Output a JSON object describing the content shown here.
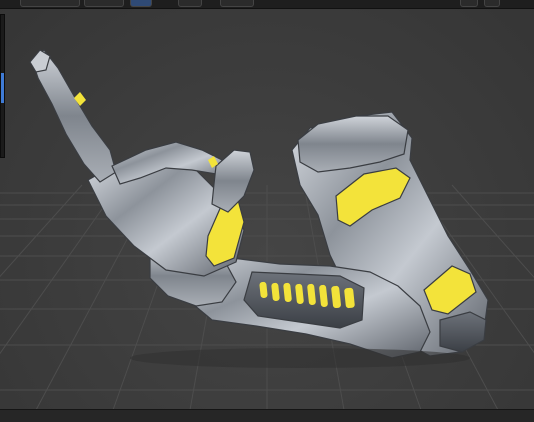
{
  "app": {
    "viewport_label": ""
  },
  "toolbar": {
    "buttons": [
      {
        "name": "toolbar-button-1"
      },
      {
        "name": "toolbar-button-2"
      },
      {
        "name": "toolbar-button-3"
      },
      {
        "name": "toolbar-button-4"
      },
      {
        "name": "toolbar-button-5"
      },
      {
        "name": "toolbar-button-6"
      },
      {
        "name": "toolbar-button-7"
      }
    ]
  },
  "scene": {
    "object": "robotic-arm-model",
    "accent_color": "#f3e33a",
    "metal_color": "#9aa0a8",
    "grid_color": "#4e4e4e",
    "background_color": "#3c3c3c"
  }
}
